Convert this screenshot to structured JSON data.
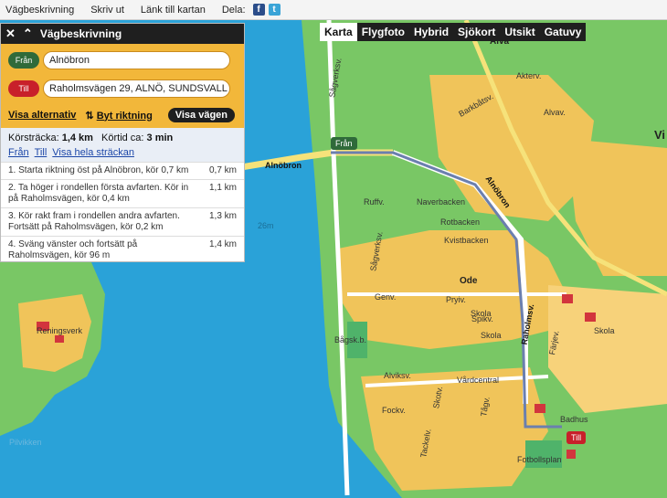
{
  "topbar": {
    "directions": "Vägbeskrivning",
    "print": "Skriv ut",
    "link": "Länk till kartan",
    "share": "Dela:"
  },
  "maptypes": [
    "Karta",
    "Flygfoto",
    "Hybrid",
    "Sjökort",
    "Utsikt",
    "Gatuvy"
  ],
  "panel": {
    "title": "Vägbeskrivning",
    "from_label": "Från",
    "to_label": "Till",
    "from_value": "Alnöbron",
    "to_value": "Raholmsvägen 29, ALNÖ, SUNDSVALL",
    "alternatives": "Visa alternativ",
    "swap": "Byt riktning",
    "show_route": "Visa vägen",
    "distance_label": "Körsträcka:",
    "distance_value": "1,4 km",
    "time_label": "Körtid ca:",
    "time_value": "3 min",
    "link_from": "Från",
    "link_to": "Till",
    "link_whole": "Visa hela sträckan",
    "steps": [
      {
        "text": "1. Starta riktning öst på Alnöbron, kör 0,7 km",
        "dist": "0,7 km"
      },
      {
        "text": "2. Ta höger i rondellen första avfarten. Kör in på Raholmsvägen, kör 0,4 km",
        "dist": "1,1 km"
      },
      {
        "text": "3. Kör rakt fram i rondellen andra avfarten. Fortsätt på Raholmsvägen, kör 0,2 km",
        "dist": "1,3 km"
      },
      {
        "text": "4. Sväng vänster och fortsätt på Raholmsvägen, kör 96 m",
        "dist": "1,4 km"
      }
    ]
  },
  "map": {
    "labels": {
      "alva": "Alva",
      "vi": "Vi",
      "ode": "Ode",
      "skola1": "Skola",
      "skola2": "Skola",
      "skola3": "Skola",
      "reningsverk": "Reningsverk",
      "bagsk": "Bågsk.b.",
      "vardcentral": "Vårdcentral",
      "badhus": "Badhus",
      "fotbollsplan": "Fotbollsplan",
      "alnobron": "Alnöbron",
      "alnobron2": "Alnöbron",
      "raholmsv": "Raholmsv.",
      "sagverksv1": "Sågverksv.",
      "sagverksv2": "Sågverksv.",
      "barkbatsv": "Barkbåtsv.",
      "akterv": "Akterv.",
      "alvav": "Alvav.",
      "ruffv": "Ruffv.",
      "naverbacken": "Naverbacken",
      "rotbacken": "Rotbacken",
      "kvistbacken": "Kvistbacken",
      "genv": "Genv.",
      "pryiv": "Pryiv.",
      "spikv": "Spikv.",
      "alviksv": "Alviksv.",
      "fockv": "Fockv.",
      "tackelv": "Tackelv.",
      "skotv": "Skotv.",
      "tagv": "Tågv.",
      "farjev": "Färjev.",
      "pilvikken": "Pilvikken",
      "depth": "26m"
    },
    "marker_from": "Från",
    "marker_to": "Till"
  }
}
